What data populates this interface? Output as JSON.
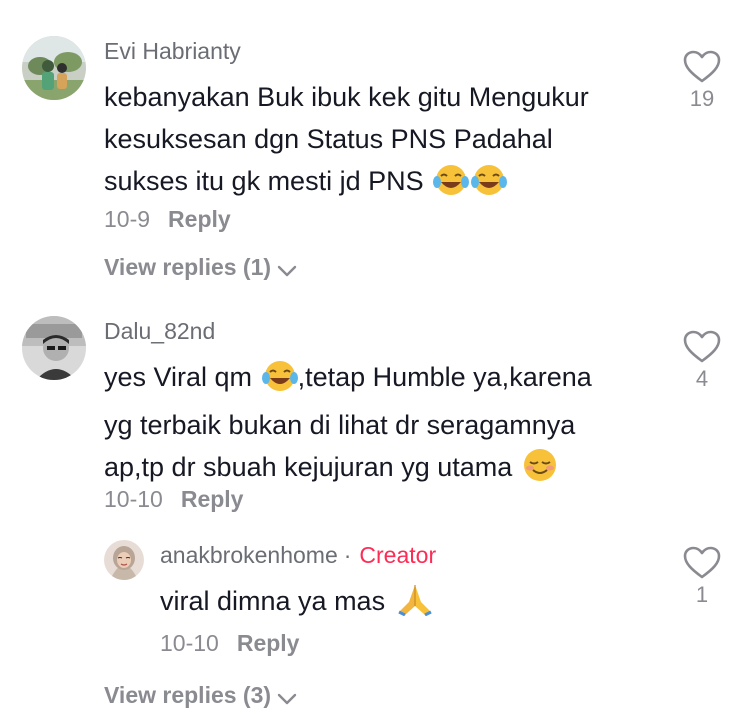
{
  "comments": [
    {
      "username": "Evi Habrianty",
      "text_lines": [
        "kebanyakan Buk ibuk kek gitu Mengukur",
        "kesuksesan dgn Status PNS Padahal",
        "sukses itu gk mesti jd PNS"
      ],
      "date": "10-9",
      "reply_label": "Reply",
      "likes": "19",
      "view_replies": "View replies (1)"
    },
    {
      "username": "Dalu_82nd",
      "text_line1_before": "yes Viral qm",
      "text_line1_after": ",tetap Humble ya,karena",
      "text_line2": "yg terbaik bukan di lihat dr seragamnya",
      "text_line3": "ap,tp dr sbuah kejujuran yg utama",
      "date": "10-10",
      "reply_label": "Reply",
      "likes": "4"
    }
  ],
  "reply": {
    "username": "anakbrokenhome",
    "separator": "·",
    "badge": "Creator",
    "text": "viral dimna ya mas",
    "date": "10-10",
    "reply_label": "Reply",
    "likes": "1"
  },
  "bottom_view_replies": "View replies (3)",
  "icons": {
    "like": "heart-outline-icon",
    "laugh": "face-with-tears-of-joy-emoji",
    "smile": "smiling-face-emoji",
    "pray": "folded-hands-emoji",
    "chevron": "chevron-down-icon"
  },
  "colors": {
    "creator_badge": "#fe2c55",
    "secondary_text": "#8a8b91",
    "primary_text": "#161823"
  }
}
